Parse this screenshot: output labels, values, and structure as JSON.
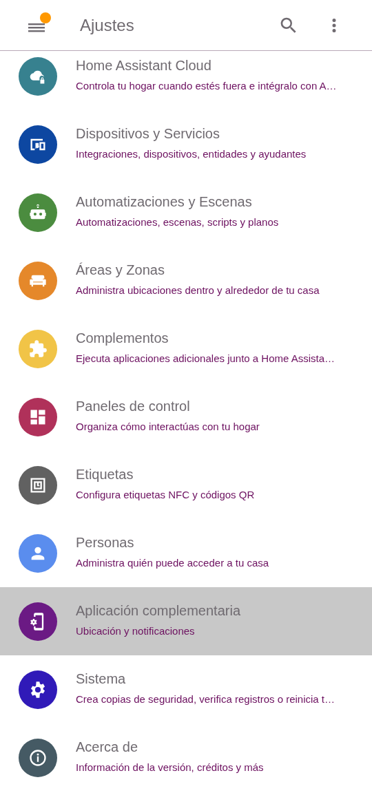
{
  "app_bar": {
    "title": "Ajustes",
    "notification": true
  },
  "items": [
    {
      "title": "Home Assistant Cloud",
      "subtitle": "Controla tu hogar cuando estés fuera e intégralo con A…",
      "color": "#37818f",
      "selected": false
    },
    {
      "title": "Dispositivos y Servicios",
      "subtitle": "Integraciones, dispositivos, entidades y ayudantes",
      "color": "#0d47a1",
      "selected": false
    },
    {
      "title": "Automatizaciones y Escenas",
      "subtitle": "Automatizaciones, escenas, scripts y planos",
      "color": "#4b8c3f",
      "selected": false
    },
    {
      "title": "Áreas y Zonas",
      "subtitle": "Administra ubicaciones dentro y alrededor de tu casa",
      "color": "#e5882a",
      "selected": false
    },
    {
      "title": "Complementos",
      "subtitle": "Ejecuta aplicaciones adicionales junto a Home Assista…",
      "color": "#f1c447",
      "selected": false
    },
    {
      "title": "Paneles de control",
      "subtitle": "Organiza cómo interactúas con tu hogar",
      "color": "#b0315a",
      "selected": false
    },
    {
      "title": "Etiquetas",
      "subtitle": "Configura etiquetas NFC y códigos QR",
      "color": "#616161",
      "selected": false
    },
    {
      "title": "Personas",
      "subtitle": "Administra quién puede acceder a tu casa",
      "color": "#5a8dee",
      "selected": false
    },
    {
      "title": "Aplicación complementaria",
      "subtitle": "Ubicación y notificaciones",
      "color": "#6b1a84",
      "selected": true
    },
    {
      "title": "Sistema",
      "subtitle": "Crea copias de seguridad, verifica registros o reinicia t…",
      "color": "#301ab8",
      "selected": false
    },
    {
      "title": "Acerca de",
      "subtitle": "Información de la versión, créditos y más",
      "color": "#455a64",
      "selected": false
    }
  ]
}
